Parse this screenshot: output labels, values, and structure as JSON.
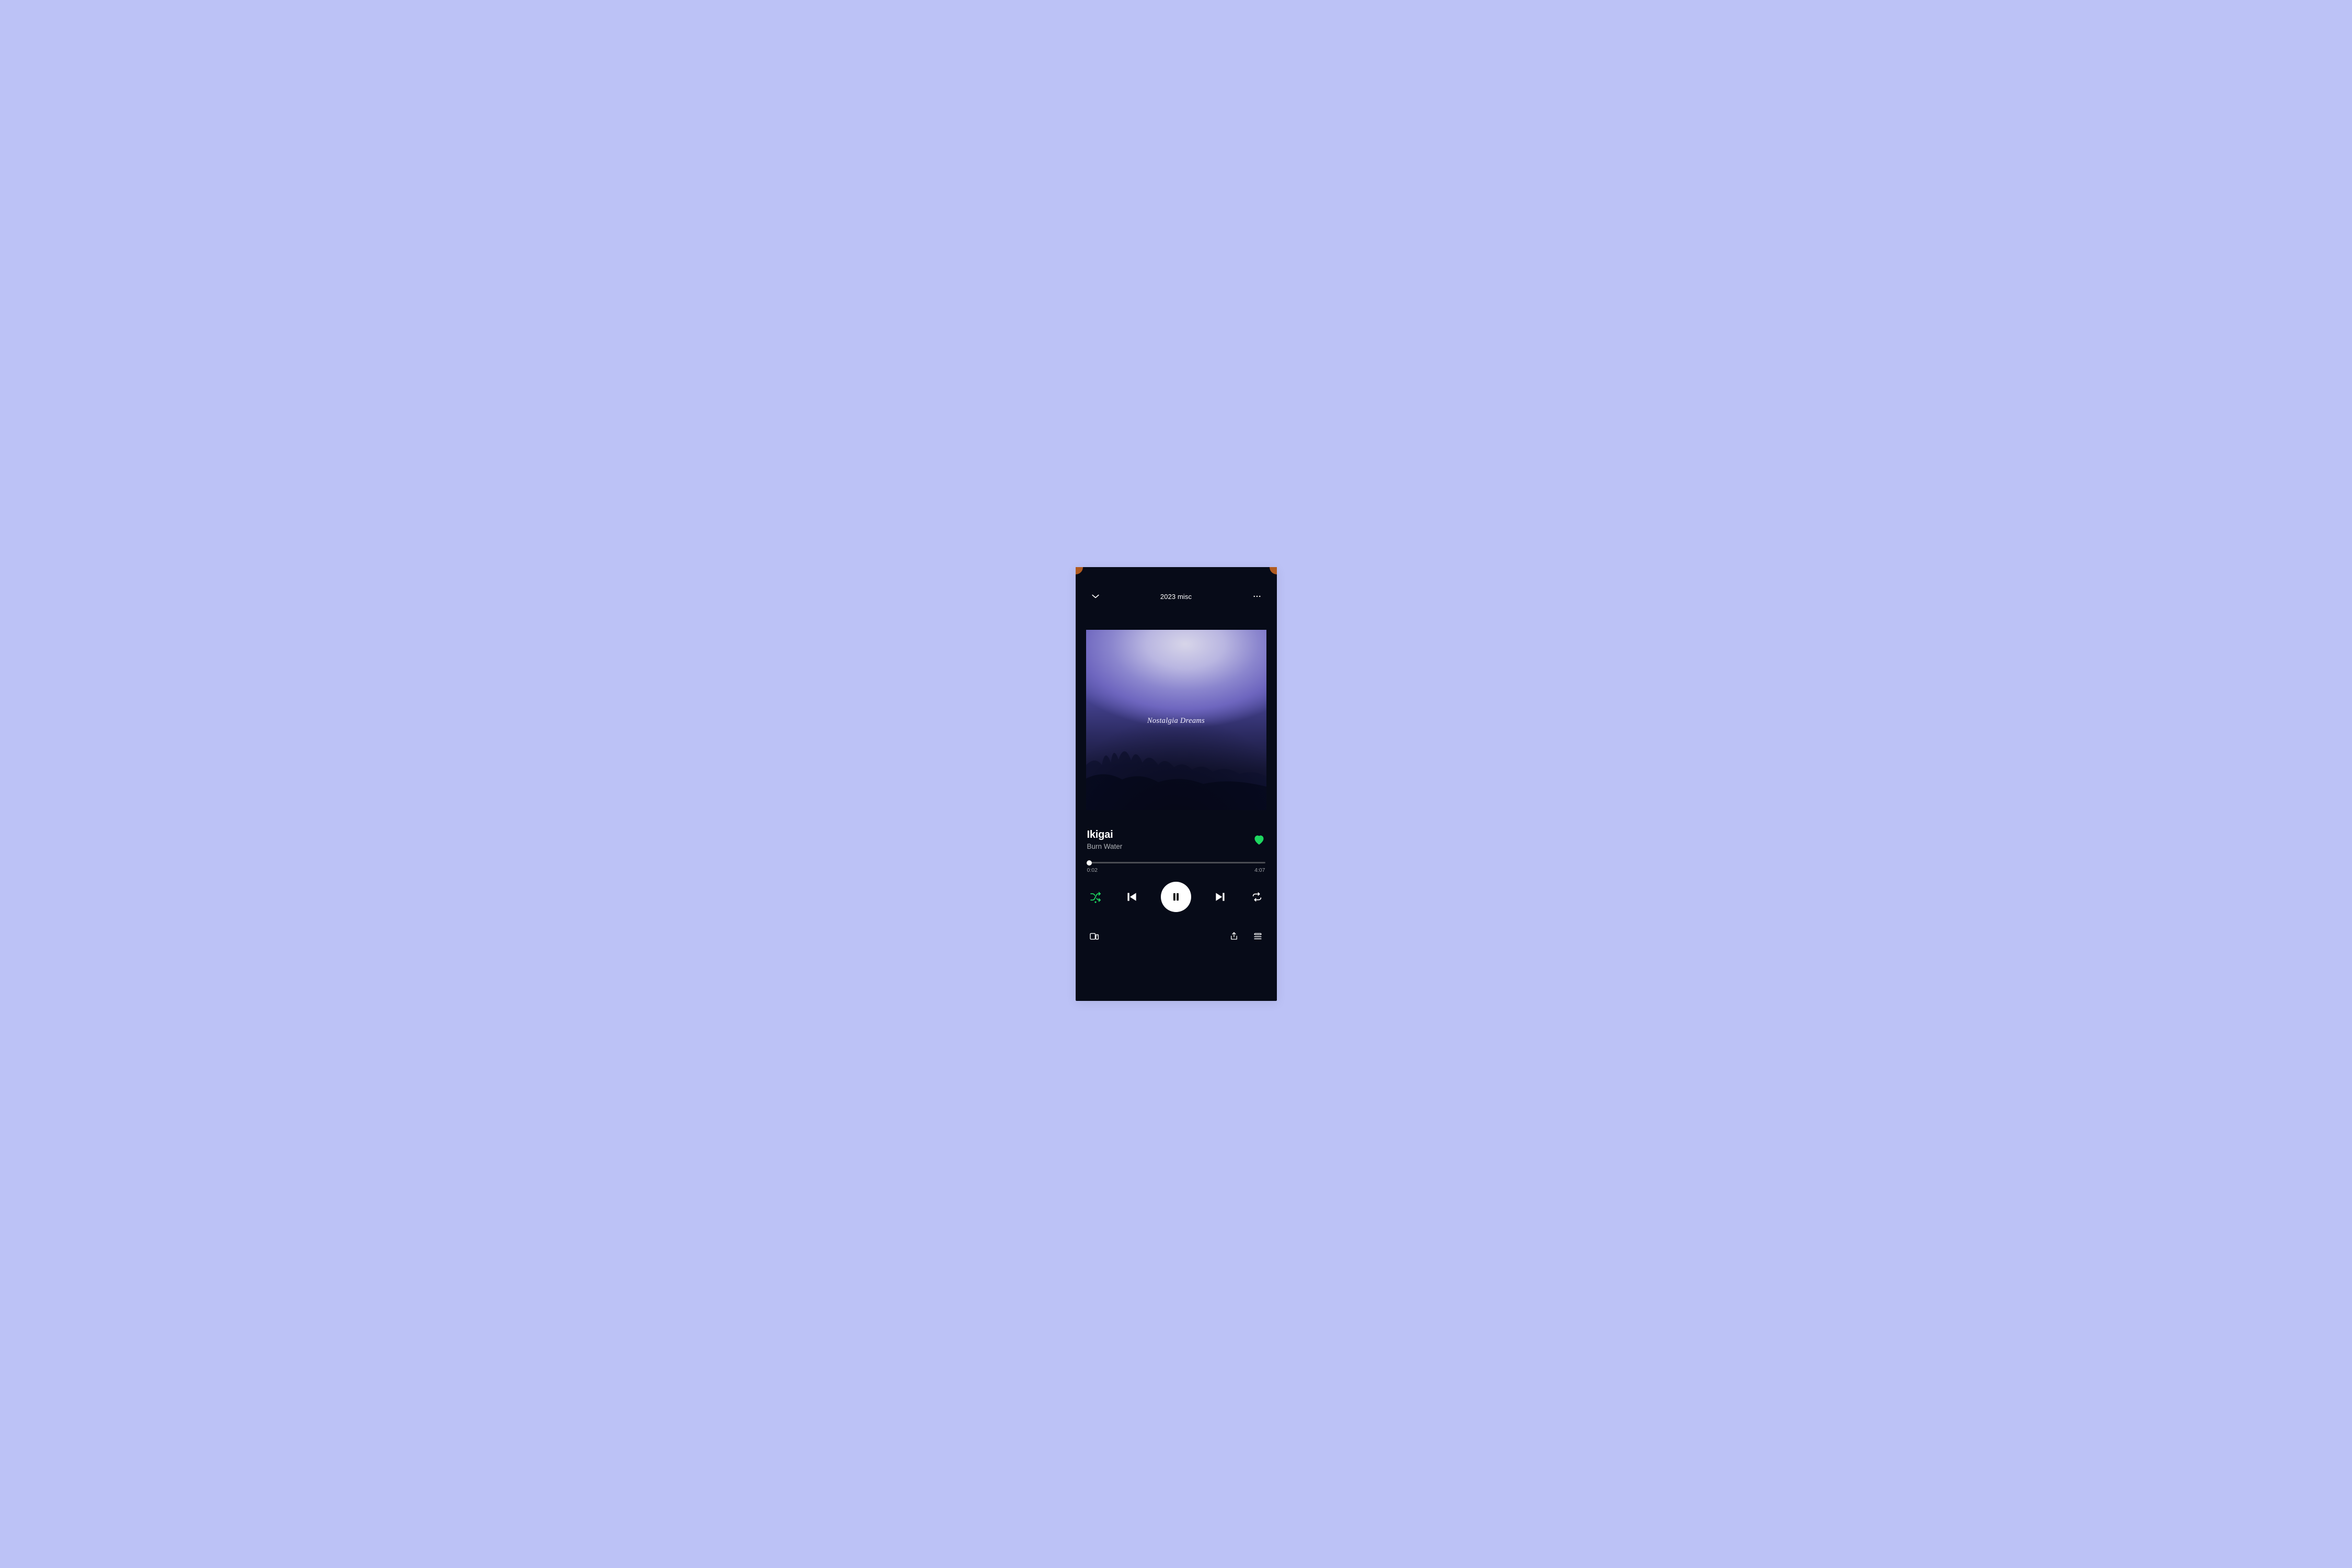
{
  "colors": {
    "page_bg": "#bcc2f6",
    "phone_bg": "#070b18",
    "accent_green": "#1ed760",
    "text_muted": "#aeb1b6",
    "progress_bg": "#4a4c52"
  },
  "header": {
    "context_label": "2023 misc"
  },
  "album_art": {
    "overlay_text": "Nostalgia Dreams"
  },
  "track": {
    "title": "Ikigai",
    "artist": "Burn Water",
    "liked": true
  },
  "progress": {
    "elapsed": "0:02",
    "duration": "4:07",
    "percent": 1.2
  },
  "controls": {
    "shuffle_active": true,
    "repeat_mode": "off",
    "is_playing": true
  },
  "icons": {
    "collapse": "chevron-down-icon",
    "more": "more-icon",
    "heart": "heart-icon",
    "shuffle": "shuffle-icon",
    "previous": "previous-icon",
    "pause": "pause-icon",
    "next": "next-icon",
    "repeat": "repeat-icon",
    "devices": "devices-icon",
    "share": "share-icon",
    "queue": "queue-icon"
  }
}
